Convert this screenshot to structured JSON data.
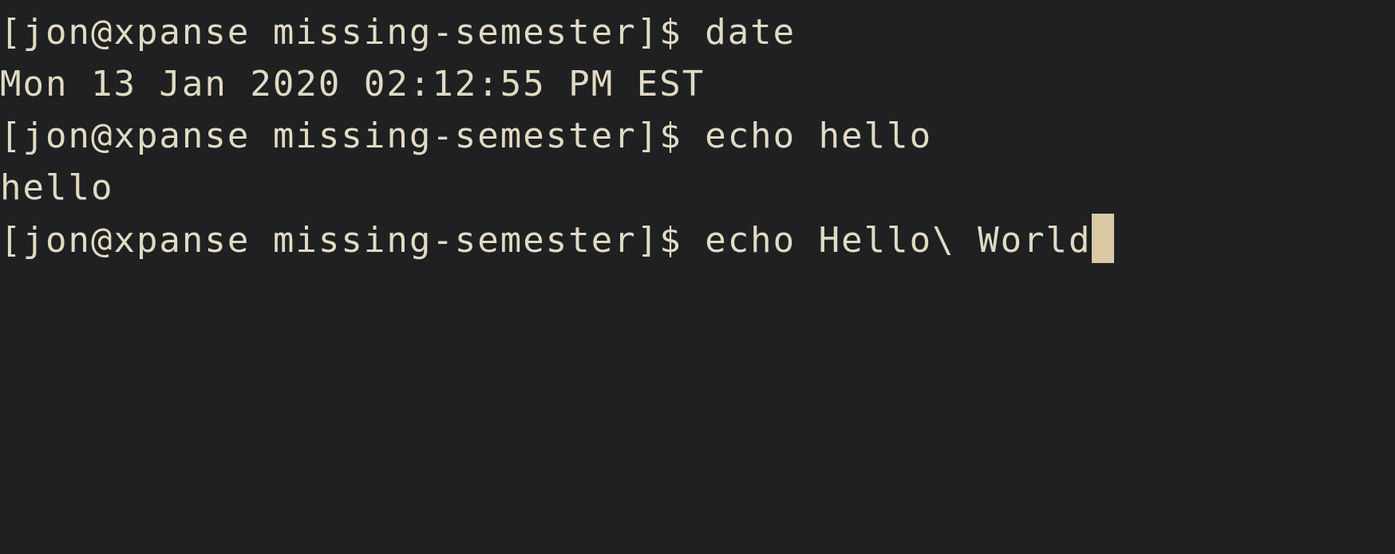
{
  "terminal": {
    "colors": {
      "background": "#1f2022",
      "foreground": "#e2dac0",
      "cursor": "#d9c9a3"
    },
    "lines": [
      {
        "type": "command",
        "prompt": "[jon@xpanse missing-semester]$ ",
        "command": "date"
      },
      {
        "type": "output",
        "text": "Mon 13 Jan 2020 02:12:55 PM EST"
      },
      {
        "type": "command",
        "prompt": "[jon@xpanse missing-semester]$ ",
        "command": "echo hello"
      },
      {
        "type": "output",
        "text": "hello"
      },
      {
        "type": "command",
        "prompt": "[jon@xpanse missing-semester]$ ",
        "command": "echo Hello\\ World"
      }
    ]
  }
}
